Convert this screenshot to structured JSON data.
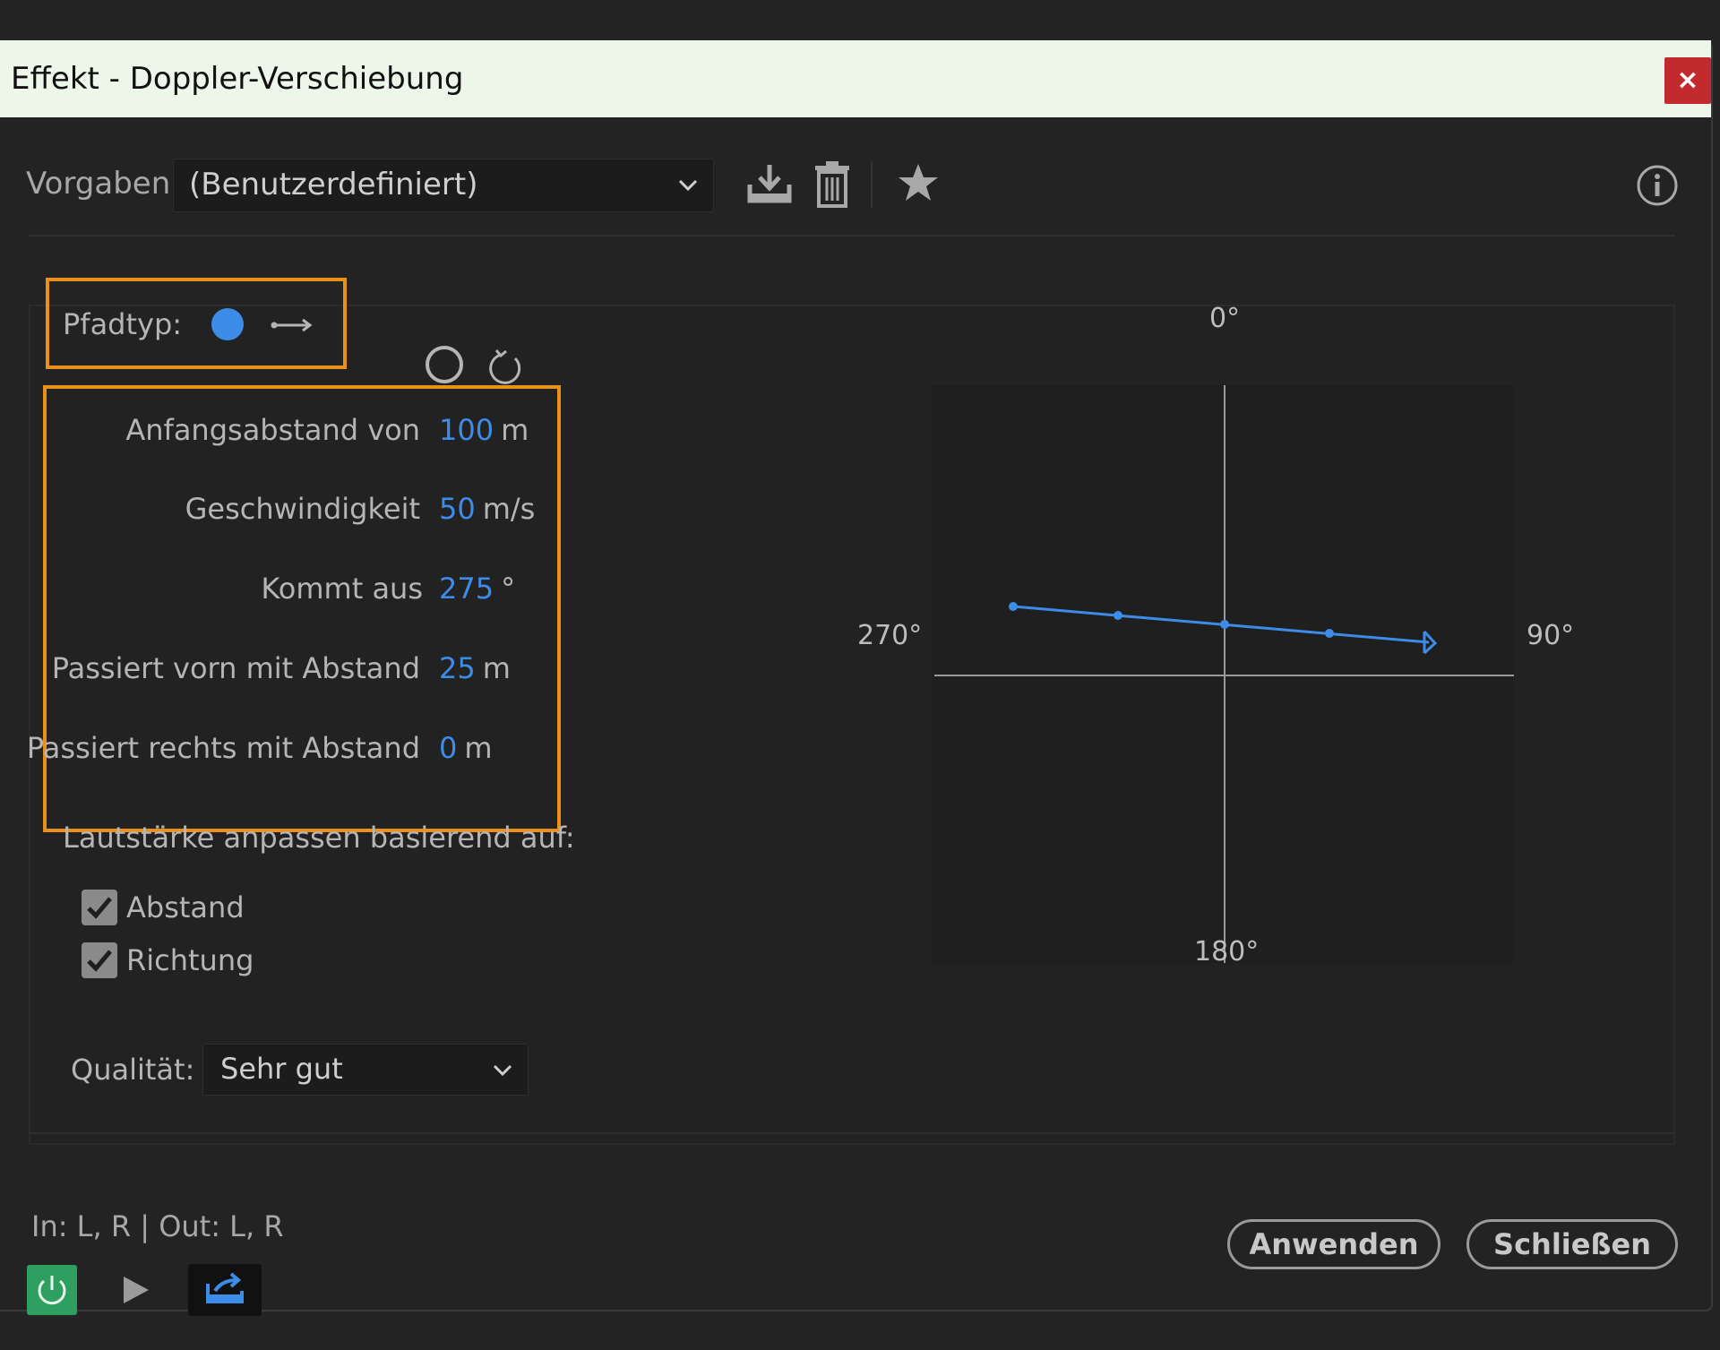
{
  "dialog": {
    "title": "Effekt - Doppler-Verschiebung",
    "close_label": "×"
  },
  "presets": {
    "label": "Vorgaben:",
    "value": "(Benutzerdefiniert)"
  },
  "toolbar_icons": [
    "download-preset-icon",
    "delete-preset-icon",
    "favorite-star-icon",
    "info-icon"
  ],
  "path_type": {
    "label": "Pfadtyp:",
    "options": [
      {
        "icon": "straight-path-icon",
        "selected": true
      },
      {
        "icon": "circular-path-icon",
        "selected": false
      }
    ]
  },
  "params": [
    {
      "label": "Anfangsabstand von",
      "value": "100",
      "unit": "m"
    },
    {
      "label": "Geschwindigkeit",
      "value": "50",
      "unit": "m/s"
    },
    {
      "label": "Kommt aus",
      "value": "275",
      "unit": "°"
    },
    {
      "label": "Passiert vorn mit Abstand",
      "value": "25",
      "unit": "m"
    },
    {
      "label": "Passiert rechts mit Abstand",
      "value": "0",
      "unit": "m"
    }
  ],
  "volume": {
    "heading": "Lautstärke anpassen basierend auf:",
    "options": [
      {
        "label": "Abstand",
        "checked": true
      },
      {
        "label": "Richtung",
        "checked": true
      }
    ]
  },
  "quality": {
    "label": "Qualität:",
    "value": "Sehr gut"
  },
  "compass": {
    "top": "0°",
    "right": "90°",
    "bottom": "180°",
    "left": "270°"
  },
  "footer": {
    "io": "In: L, R | Out: L, R",
    "apply": "Anwenden",
    "close": "Schließen"
  },
  "colors": {
    "accent": "#3d8ce8",
    "highlight": "#e8901a",
    "power": "#2e9f5f"
  }
}
